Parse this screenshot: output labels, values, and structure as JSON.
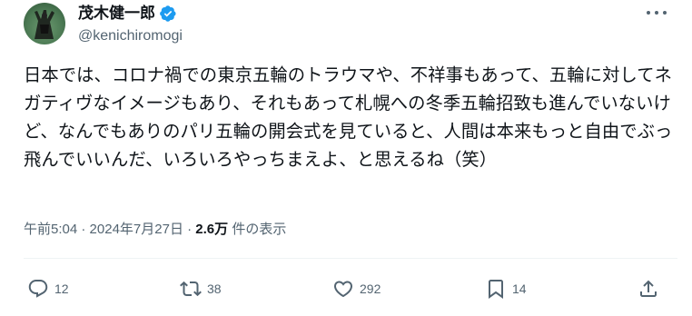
{
  "author": {
    "display_name": "茂木健一郎",
    "handle": "@kenichiromogi",
    "verified": true,
    "verified_color": "#1d9bf0"
  },
  "tweet": {
    "text": "日本では、コロナ禍での東京五輪のトラウマや、不祥事もあって、五輪に対してネガティヴなイメージもあり、それもあって札幌への冬季五輪招致も進んでいないけど、なんでもありのパリ五輪の開会式を見ていると、人間は本来もっと自由でぶっ飛んでいいんだ、いろいろやっちまえよ、と思えるね（笑）"
  },
  "meta": {
    "time": "午前5:04",
    "separator": " · ",
    "date": "2024年7月27日",
    "views_count": "2.6万",
    "views_label": " 件の表示"
  },
  "actions": {
    "reply_count": "12",
    "repost_count": "38",
    "like_count": "292",
    "bookmark_count": "14"
  },
  "icons": {
    "more": "more-icon",
    "reply": "reply-icon",
    "repost": "repost-icon",
    "like": "heart-icon",
    "bookmark": "bookmark-icon",
    "share": "share-icon"
  },
  "colors": {
    "text_primary": "#0f1419",
    "text_secondary": "#536471",
    "divider": "#eff3f4"
  }
}
